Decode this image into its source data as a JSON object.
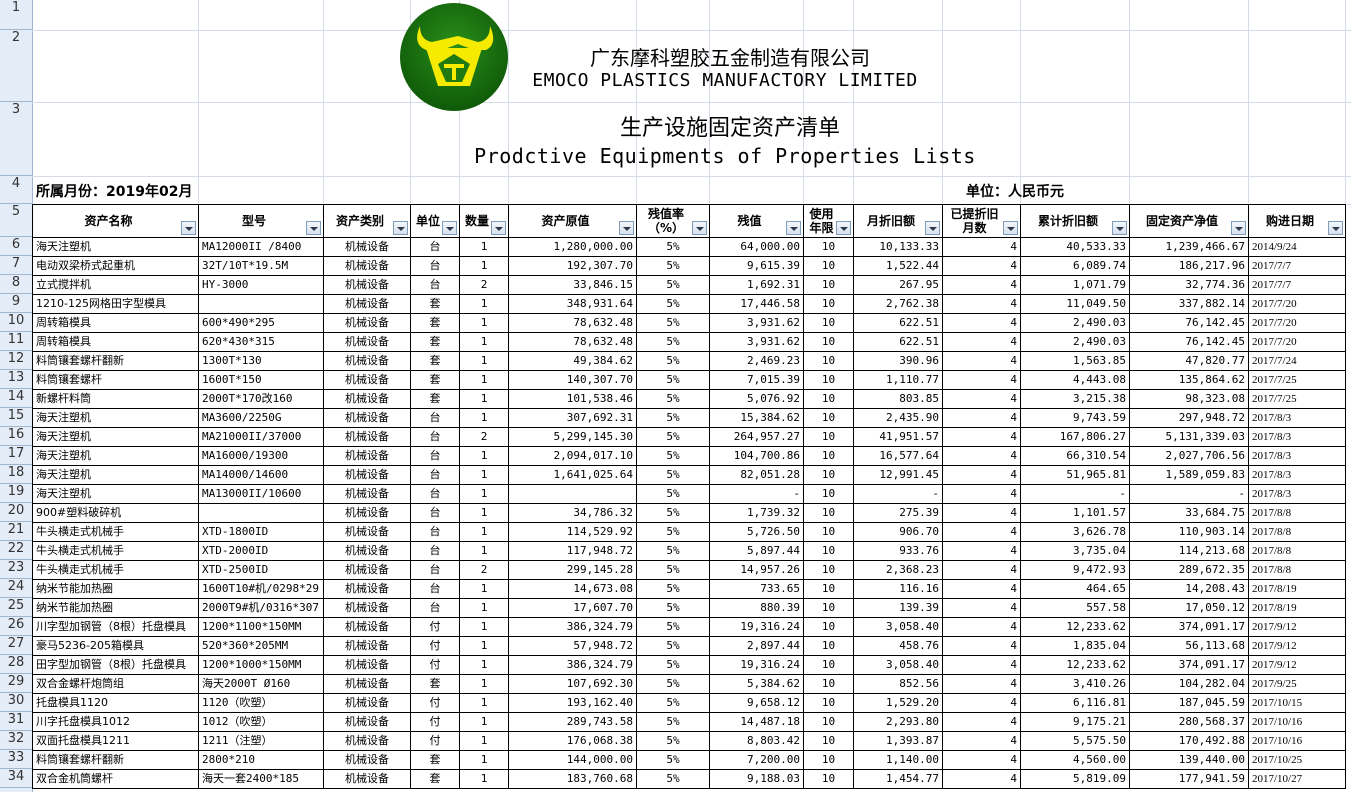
{
  "header": {
    "company_cn": "广东摩科塑胶五金制造有限公司",
    "company_en": "EMOCO PLASTICS MANUFACTORY LIMITED",
    "title_cn": "生产设施固定资产清单",
    "title_en": "Prodctive Equipments of Properties Lists",
    "month_label": "所属月份：2019年02月",
    "unit_label": "单位：人民币元",
    "logo": "bull-head-logo",
    "colors": {
      "logo_green": "#1f7a12",
      "logo_yellow": "#f5ea00"
    }
  },
  "row_numbers": [
    "1",
    "2",
    "3",
    "4",
    "5",
    "6",
    "7",
    "8",
    "9",
    "10",
    "11",
    "12",
    "13",
    "14",
    "15",
    "16",
    "17",
    "18",
    "19",
    "20",
    "21",
    "22",
    "23",
    "24",
    "25",
    "26",
    "27",
    "28",
    "29",
    "30",
    "31",
    "32",
    "33",
    "34"
  ],
  "columns": [
    {
      "label": "资产名称"
    },
    {
      "label": "型号"
    },
    {
      "label": "资产类别"
    },
    {
      "label": "单位"
    },
    {
      "label": "数量"
    },
    {
      "label": "资产原值"
    },
    {
      "label": "残值率（%）"
    },
    {
      "label": "残值"
    },
    {
      "label": "使用年限"
    },
    {
      "label": "月折旧额"
    },
    {
      "label": "已提折旧月数"
    },
    {
      "label": "累计折旧额"
    },
    {
      "label": "固定资产净值"
    },
    {
      "label": "购进日期"
    }
  ],
  "rows": [
    [
      "海天注塑机",
      "MA12000II /8400",
      "机械设备",
      "台",
      "1",
      "1,280,000.00",
      "5%",
      "64,000.00",
      "10",
      "10,133.33",
      "4",
      "40,533.33",
      "1,239,466.67",
      "2014/9/24"
    ],
    [
      "电动双梁桥式起重机",
      "32T/10T*19.5M",
      "机械设备",
      "台",
      "1",
      "192,307.70",
      "5%",
      "9,615.39",
      "10",
      "1,522.44",
      "4",
      "6,089.74",
      "186,217.96",
      "2017/7/7"
    ],
    [
      "立式搅拌机",
      "HY-3000",
      "机械设备",
      "台",
      "2",
      "33,846.15",
      "5%",
      "1,692.31",
      "10",
      "267.95",
      "4",
      "1,071.79",
      "32,774.36",
      "2017/7/7"
    ],
    [
      "1210-125网格田字型模具",
      "",
      "机械设备",
      "套",
      "1",
      "348,931.64",
      "5%",
      "17,446.58",
      "10",
      "2,762.38",
      "4",
      "11,049.50",
      "337,882.14",
      "2017/7/20"
    ],
    [
      "周转箱模具",
      "600*490*295",
      "机械设备",
      "套",
      "1",
      "78,632.48",
      "5%",
      "3,931.62",
      "10",
      "622.51",
      "4",
      "2,490.03",
      "76,142.45",
      "2017/7/20"
    ],
    [
      "周转箱模具",
      "620*430*315",
      "机械设备",
      "套",
      "1",
      "78,632.48",
      "5%",
      "3,931.62",
      "10",
      "622.51",
      "4",
      "2,490.03",
      "76,142.45",
      "2017/7/20"
    ],
    [
      "料筒镶套螺杆翻新",
      "1300T*130",
      "机械设备",
      "套",
      "1",
      "49,384.62",
      "5%",
      "2,469.23",
      "10",
      "390.96",
      "4",
      "1,563.85",
      "47,820.77",
      "2017/7/24"
    ],
    [
      "料筒镶套螺杆",
      "1600T*150",
      "机械设备",
      "套",
      "1",
      "140,307.70",
      "5%",
      "7,015.39",
      "10",
      "1,110.77",
      "4",
      "4,443.08",
      "135,864.62",
      "2017/7/25"
    ],
    [
      "新螺杆料筒",
      "2000T*170改160",
      "机械设备",
      "套",
      "1",
      "101,538.46",
      "5%",
      "5,076.92",
      "10",
      "803.85",
      "4",
      "3,215.38",
      "98,323.08",
      "2017/7/25"
    ],
    [
      "海天注塑机",
      "MA3600/2250G",
      "机械设备",
      "台",
      "1",
      "307,692.31",
      "5%",
      "15,384.62",
      "10",
      "2,435.90",
      "4",
      "9,743.59",
      "297,948.72",
      "2017/8/3"
    ],
    [
      "海天注塑机",
      "MA21000II/37000",
      "机械设备",
      "台",
      "2",
      "5,299,145.30",
      "5%",
      "264,957.27",
      "10",
      "41,951.57",
      "4",
      "167,806.27",
      "5,131,339.03",
      "2017/8/3"
    ],
    [
      "海天注塑机",
      "MA16000/19300",
      "机械设备",
      "台",
      "1",
      "2,094,017.10",
      "5%",
      "104,700.86",
      "10",
      "16,577.64",
      "4",
      "66,310.54",
      "2,027,706.56",
      "2017/8/3"
    ],
    [
      "海天注塑机",
      "MA14000/14600",
      "机械设备",
      "台",
      "1",
      "1,641,025.64",
      "5%",
      "82,051.28",
      "10",
      "12,991.45",
      "4",
      "51,965.81",
      "1,589,059.83",
      "2017/8/3"
    ],
    [
      "海天注塑机",
      "MA13000II/10600",
      "机械设备",
      "台",
      "1",
      "",
      "5%",
      "-",
      "10",
      "-",
      "4",
      "-",
      "-",
      "2017/8/3"
    ],
    [
      "900#塑料破碎机",
      "",
      "机械设备",
      "台",
      "1",
      "34,786.32",
      "5%",
      "1,739.32",
      "10",
      "275.39",
      "4",
      "1,101.57",
      "33,684.75",
      "2017/8/8"
    ],
    [
      "牛头横走式机械手",
      "XTD-1800ID",
      "机械设备",
      "台",
      "1",
      "114,529.92",
      "5%",
      "5,726.50",
      "10",
      "906.70",
      "4",
      "3,626.78",
      "110,903.14",
      "2017/8/8"
    ],
    [
      "牛头横走式机械手",
      "XTD-2000ID",
      "机械设备",
      "台",
      "1",
      "117,948.72",
      "5%",
      "5,897.44",
      "10",
      "933.76",
      "4",
      "3,735.04",
      "114,213.68",
      "2017/8/8"
    ],
    [
      "牛头横走式机械手",
      "XTD-2500ID",
      "机械设备",
      "台",
      "2",
      "299,145.28",
      "5%",
      "14,957.26",
      "10",
      "2,368.23",
      "4",
      "9,472.93",
      "289,672.35",
      "2017/8/8"
    ],
    [
      "纳米节能加热圈",
      "1600T10#机/0298*29",
      "机械设备",
      "台",
      "1",
      "14,673.08",
      "5%",
      "733.65",
      "10",
      "116.16",
      "4",
      "464.65",
      "14,208.43",
      "2017/8/19"
    ],
    [
      "纳米节能加热圈",
      "2000T9#机/0316*307",
      "机械设备",
      "台",
      "1",
      "17,607.70",
      "5%",
      "880.39",
      "10",
      "139.39",
      "4",
      "557.58",
      "17,050.12",
      "2017/8/19"
    ],
    [
      "川字型加钢管（8根）托盘模具",
      "1200*1100*150MM",
      "机械设备",
      "付",
      "1",
      "386,324.79",
      "5%",
      "19,316.24",
      "10",
      "3,058.40",
      "4",
      "12,233.62",
      "374,091.17",
      "2017/9/12"
    ],
    [
      "豪马5236-205箱模具",
      "520*360*205MM",
      "机械设备",
      "付",
      "1",
      "57,948.72",
      "5%",
      "2,897.44",
      "10",
      "458.76",
      "4",
      "1,835.04",
      "56,113.68",
      "2017/9/12"
    ],
    [
      "田字型加钢管（8根）托盘模具",
      "1200*1000*150MM",
      "机械设备",
      "付",
      "1",
      "386,324.79",
      "5%",
      "19,316.24",
      "10",
      "3,058.40",
      "4",
      "12,233.62",
      "374,091.17",
      "2017/9/12"
    ],
    [
      "双合金螺杆炮筒组",
      "海天2000T Ø160",
      "机械设备",
      "套",
      "1",
      "107,692.30",
      "5%",
      "5,384.62",
      "10",
      "852.56",
      "4",
      "3,410.26",
      "104,282.04",
      "2017/9/25"
    ],
    [
      "托盘模具1120",
      "1120（吹塑）",
      "机械设备",
      "付",
      "1",
      "193,162.40",
      "5%",
      "9,658.12",
      "10",
      "1,529.20",
      "4",
      "6,116.81",
      "187,045.59",
      "2017/10/15"
    ],
    [
      "川字托盘模具1012",
      "1012（吹塑）",
      "机械设备",
      "付",
      "1",
      "289,743.58",
      "5%",
      "14,487.18",
      "10",
      "2,293.80",
      "4",
      "9,175.21",
      "280,568.37",
      "2017/10/16"
    ],
    [
      "双面托盘模具1211",
      "1211（注塑）",
      "机械设备",
      "付",
      "1",
      "176,068.38",
      "5%",
      "8,803.42",
      "10",
      "1,393.87",
      "4",
      "5,575.50",
      "170,492.88",
      "2017/10/16"
    ],
    [
      "料筒镶套螺杆翻新",
      "2800*210",
      "机械设备",
      "套",
      "1",
      "144,000.00",
      "5%",
      "7,200.00",
      "10",
      "1,140.00",
      "4",
      "4,560.00",
      "139,440.00",
      "2017/10/25"
    ],
    [
      "双合金机筒螺杆",
      "海天一套2400*185",
      "机械设备",
      "套",
      "1",
      "183,760.68",
      "5%",
      "9,188.03",
      "10",
      "1,454.77",
      "4",
      "5,819.09",
      "177,941.59",
      "2017/10/27"
    ]
  ]
}
